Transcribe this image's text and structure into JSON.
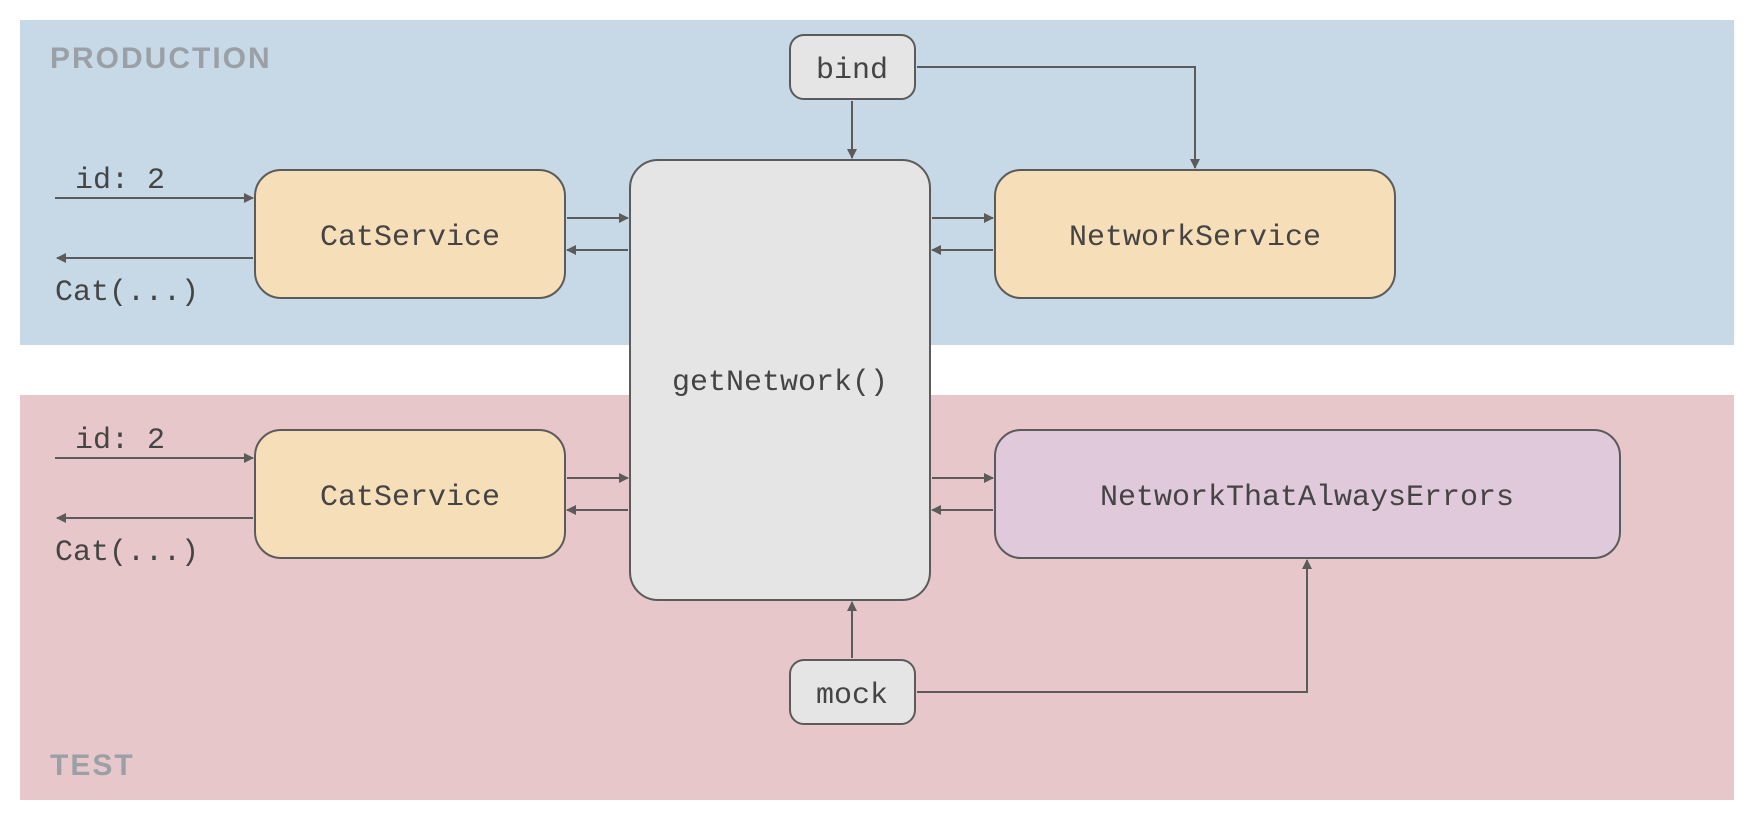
{
  "sections": {
    "production": {
      "label": "PRODUCTION",
      "bg": "#c7d8e6"
    },
    "test": {
      "label": "TEST",
      "bg": "#e7c7c9"
    }
  },
  "nodes": {
    "bind": {
      "label": "bind",
      "fill": "#e5e5e5",
      "stroke": "#5b5b5b"
    },
    "mock": {
      "label": "mock",
      "fill": "#e5e5e5",
      "stroke": "#5b5b5b"
    },
    "center": {
      "label": "getNetwork()",
      "fill": "#e5e5e5",
      "stroke": "#5b5b5b"
    },
    "cat_service_prod": {
      "label": "CatService",
      "fill": "#f6deb8",
      "stroke": "#5b5b5b"
    },
    "cat_service_test": {
      "label": "CatService",
      "fill": "#f6deb8",
      "stroke": "#5b5b5b"
    },
    "network_service": {
      "label": "NetworkService",
      "fill": "#f6deb8",
      "stroke": "#5b5b5b"
    },
    "network_errors": {
      "label": "NetworkThatAlwaysErrors",
      "fill": "#dfc9da",
      "stroke": "#5b5b5b"
    }
  },
  "io_labels": {
    "id_prod": "id: 2",
    "cat_prod": "Cat(...)",
    "id_test": "id: 2",
    "cat_test": "Cat(...)"
  },
  "colors": {
    "arrow": "#5b5b5b",
    "section_label": "#9aa0a6",
    "text": "#444444"
  }
}
